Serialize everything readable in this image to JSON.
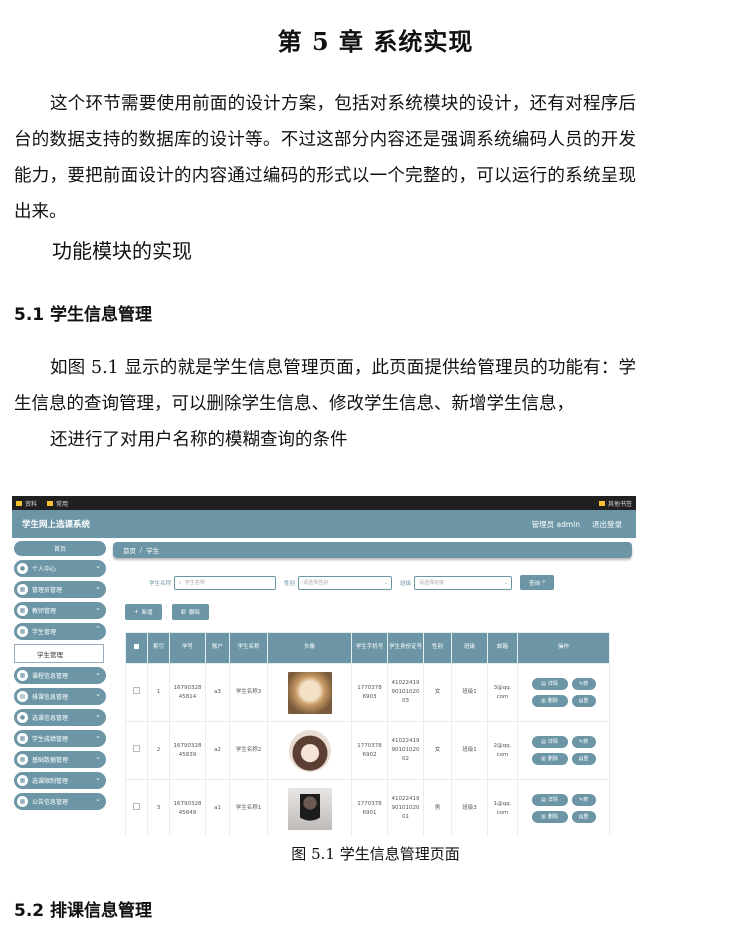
{
  "chapter_title": "第 5 章  系统实现",
  "intro_paragraph": "这个环节需要使用前面的设计方案，包括对系统模块的设计，还有对程序后台的数据支持的数据库的设计等。不过这部分内容还是强调系统编码人员的开发能力，要把前面设计的内容通过编码的形式以一个完整的，可以运行的系统呈现出来。",
  "module_heading": "功能模块的实现",
  "section_5_1": {
    "title": "5.1 学生信息管理",
    "paragraph": "如图 5.1 显示的就是学生信息管理页面，此页面提供给管理员的功能有：学生信息的查询管理，可以删除学生信息、修改学生信息、新增学生信息，",
    "paragraph2": "还进行了对用户名称的模糊查询的条件"
  },
  "figure": {
    "caption": "图 5.1  学生信息管理页面",
    "bookmarks": [
      "资料",
      "常用"
    ],
    "bookmarks_right": "其他书签",
    "app_title": "学生网上选课系统",
    "header_admin": "管理员 admin",
    "header_logout": "退出登录",
    "sidebar": {
      "home": "首页",
      "items": [
        "个人中心",
        "管理员管理",
        "教师管理",
        "学生管理"
      ],
      "sub_item": "学生管理",
      "items_after": [
        "课程信息管理",
        "排课信息管理",
        "选课信息管理",
        "学生成绩管理",
        "基础数据管理",
        "选课限制管理",
        "公告信息管理"
      ]
    },
    "breadcrumb": {
      "home": "首页",
      "sep": "/",
      "current": "学生"
    },
    "search": {
      "name_label": "学生名称",
      "name_placeholder": "学生名称",
      "gender_label": "性别",
      "gender_placeholder": "请选择性别",
      "class_label": "班级",
      "class_placeholder": "请选择班级",
      "query_button": "查询"
    },
    "actions": {
      "add": "新增",
      "delete": "删除"
    },
    "table": {
      "headers": [
        "索引",
        "学号",
        "账户",
        "学生名称",
        "头像",
        "学生手机号",
        "学生身份证号",
        "性别",
        "班级",
        "邮箱",
        "操作"
      ],
      "rows": [
        {
          "index": "1",
          "xuehao": "1679032845814",
          "account": "a3",
          "name": "学生名称3",
          "avatar": "cat-photo",
          "phone": "17703786903",
          "idcard": "410224199010102003",
          "gender": "女",
          "class": "班级1",
          "email": "3@qq.com"
        },
        {
          "index": "2",
          "xuehao": "1679032845839",
          "account": "a2",
          "name": "学生名称2",
          "avatar": "girl-illustration",
          "phone": "17703786902",
          "idcard": "410224199010102002",
          "gender": "女",
          "class": "班级1",
          "email": "2@qq.com"
        },
        {
          "index": "3",
          "xuehao": "1679032845849",
          "account": "a1",
          "name": "学生名称1",
          "avatar": "man-photo",
          "phone": "17703786901",
          "idcard": "410224199010102001",
          "gender": "男",
          "class": "班级3",
          "email": "1@qq.com"
        }
      ],
      "op_detail": "详情",
      "op_edit": "修",
      "op_delete": "删除",
      "op_reset": "重"
    }
  },
  "section_5_2": {
    "title": "5.2  排课信息管理"
  }
}
